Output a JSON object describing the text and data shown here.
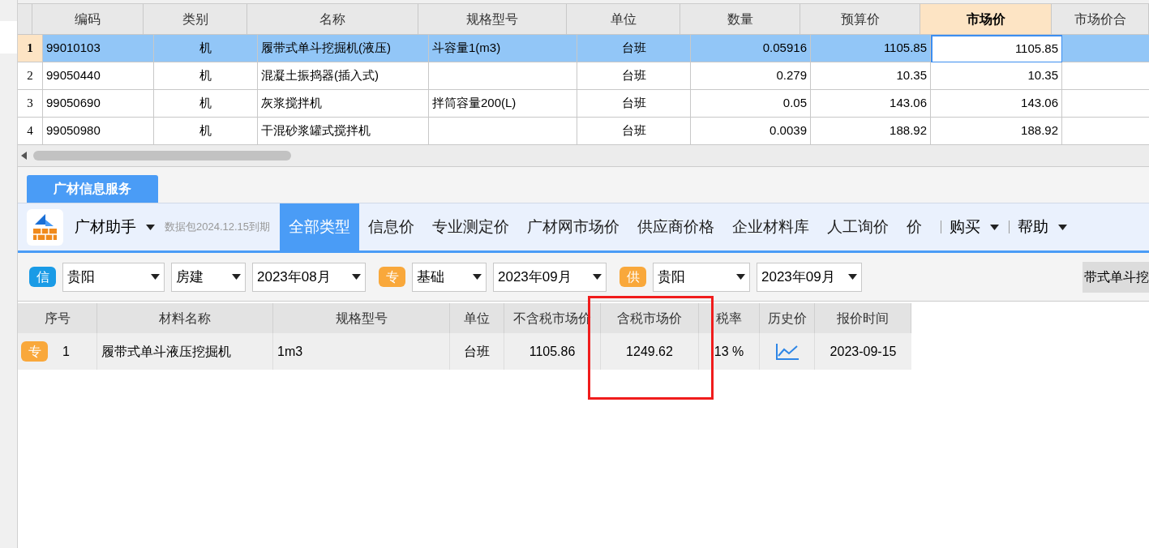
{
  "top_table": {
    "columns": [
      {
        "label": "编码",
        "selected": false
      },
      {
        "label": "类别",
        "selected": false
      },
      {
        "label": "名称",
        "selected": false
      },
      {
        "label": "规格型号",
        "selected": false
      },
      {
        "label": "单位",
        "selected": false
      },
      {
        "label": "数量",
        "selected": false
      },
      {
        "label": "预算价",
        "selected": false
      },
      {
        "label": "市场价",
        "selected": true
      },
      {
        "label": "市场价合",
        "selected": false
      }
    ],
    "rows": [
      {
        "number": "1",
        "selected": true,
        "cells": [
          "99010103",
          "机",
          "履带式单斗挖掘机(液压)",
          "斗容量1(m3)",
          "台班",
          "0.05916",
          "1105.85",
          "1105.85",
          null
        ]
      },
      {
        "number": "2",
        "selected": false,
        "cells": [
          "99050440",
          "机",
          "混凝土振捣器(插入式)",
          null,
          "台班",
          "0.279",
          "10.35",
          "10.35",
          null
        ]
      },
      {
        "number": "3",
        "selected": false,
        "cells": [
          "99050690",
          "机",
          "灰浆搅拌机",
          "拌筒容量200(L)",
          "台班",
          "0.05",
          "143.06",
          "143.06",
          null
        ]
      },
      {
        "number": "4",
        "selected": false,
        "cells": [
          "99050980",
          "机",
          "干混砂浆罐式搅拌机",
          null,
          "台班",
          "0.0039",
          "188.92",
          "188.92",
          null
        ]
      }
    ]
  },
  "panel_tab": "广材信息服务",
  "toolbar": {
    "brand": "广材助手",
    "note": "数据包2024.12.15到期",
    "categories": [
      {
        "label": "全部类型",
        "selected": true
      },
      {
        "label": "信息价",
        "selected": false
      },
      {
        "label": "专业测定价",
        "selected": false
      },
      {
        "label": "广材网市场价",
        "selected": false
      },
      {
        "label": "供应商价格",
        "selected": false
      },
      {
        "label": "企业材料库",
        "selected": false
      },
      {
        "label": "人工询价",
        "selected": false
      },
      {
        "label": "价",
        "selected": false
      }
    ],
    "menus": [
      "购买",
      "帮助"
    ]
  },
  "filters": [
    {
      "badge": "信",
      "color": "#1a9be6",
      "selects": [
        "贵阳",
        "房建",
        "2023年08月"
      ]
    },
    {
      "badge": "专",
      "color": "#f9a83b",
      "selects": [
        "基础",
        "2023年09月"
      ]
    },
    {
      "badge": "供",
      "color": "#f9a83b",
      "selects": [
        "贵阳",
        "2023年09月"
      ]
    }
  ],
  "search_text": "带式单斗挖",
  "results": {
    "columns": [
      "序号",
      "材料名称",
      "规格型号",
      "单位",
      "不含税市场价",
      "含税市场价",
      "税率",
      "历史价",
      "报价时间"
    ],
    "rows": [
      {
        "badge": "专",
        "number": "1",
        "name": "履带式单斗液压挖掘机",
        "spec": "1m3",
        "unit": "台班",
        "price_ex_tax": "1105.86",
        "price_inc_tax": "1249.62",
        "tax_rate": "13 %",
        "date": "2023-09-15"
      }
    ]
  }
}
